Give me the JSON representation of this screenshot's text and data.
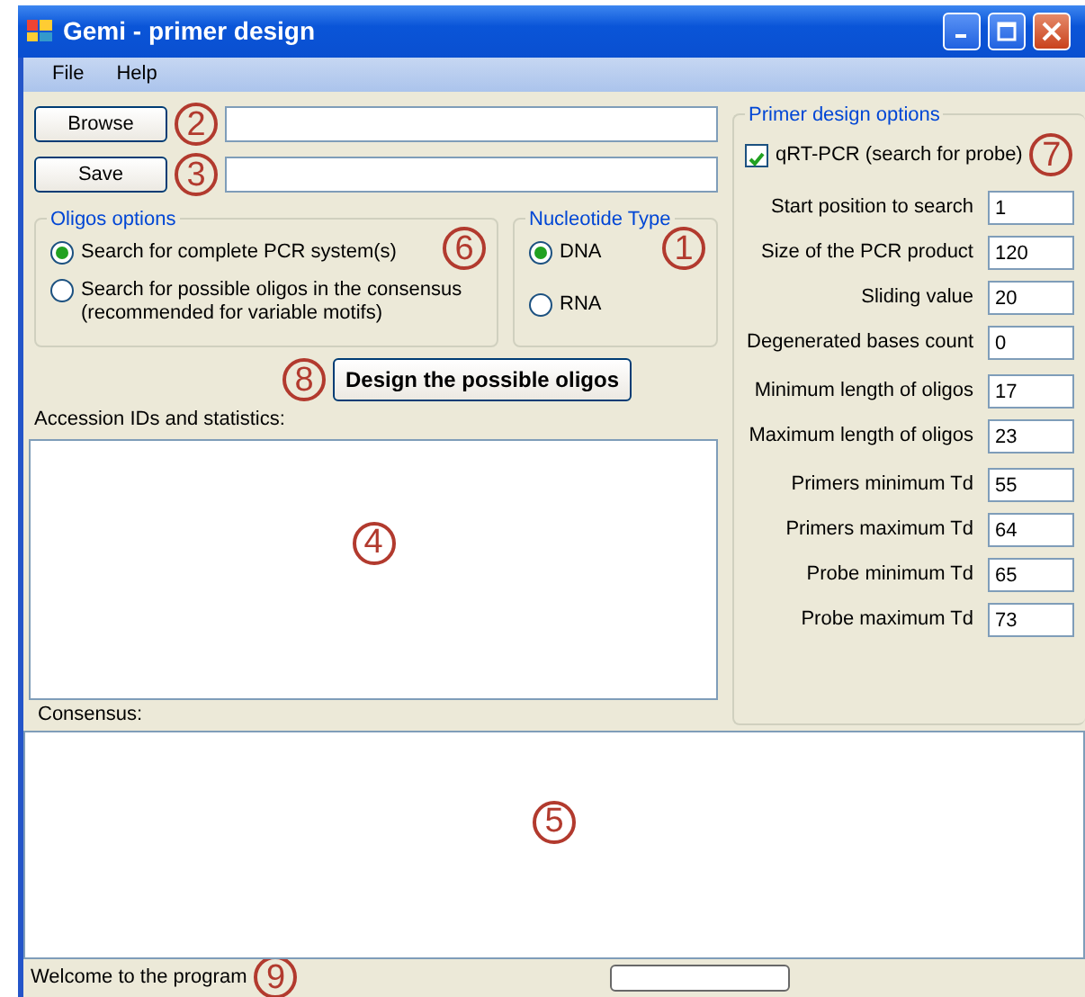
{
  "window": {
    "title": "Gemi - primer design"
  },
  "menu": [
    {
      "label": "File"
    },
    {
      "label": "Help"
    }
  ],
  "file_rows": [
    {
      "button": "Browse",
      "callout": "2"
    },
    {
      "button": "Save",
      "callout": "3"
    }
  ],
  "oligos_options": {
    "title": "Oligos options",
    "callout": "6",
    "options": [
      {
        "label": "Search for complete PCR system(s)",
        "selected": true
      },
      {
        "label": "Search for possible oligos in the consensus\n(recommended for variable motifs)",
        "selected": false
      }
    ]
  },
  "nucleotide_type": {
    "title": "Nucleotide Type",
    "callout": "1",
    "options": [
      {
        "label": "DNA",
        "selected": true
      },
      {
        "label": "RNA",
        "selected": false
      }
    ]
  },
  "design_button": {
    "label": "Design the possible oligos",
    "callout": "8"
  },
  "accession": {
    "label": "Accession IDs and statistics:",
    "callout": "4"
  },
  "primer_options": {
    "title": "Primer design options",
    "callout": "7",
    "checkbox": {
      "label": "qRT-PCR (search for probe)",
      "checked": true
    },
    "groups": [
      {
        "fields": [
          {
            "label": "Start position to search",
            "value": "1"
          },
          {
            "label": "Size of the PCR product",
            "value": "120"
          },
          {
            "label": "Sliding value",
            "value": "20"
          },
          {
            "label": "Degenerated bases count",
            "value": "0"
          }
        ]
      },
      {
        "fields": [
          {
            "label": "Minimum length of oligos",
            "value": "17"
          },
          {
            "label": "Maximum length of oligos",
            "value": "23"
          }
        ]
      },
      {
        "fields": [
          {
            "label": "Primers minimum Td",
            "value": "55"
          },
          {
            "label": "Primers maximum Td",
            "value": "64"
          },
          {
            "label": "Probe minimum Td",
            "value": "65"
          },
          {
            "label": "Probe maximum Td",
            "value": "73"
          }
        ]
      }
    ]
  },
  "consensus": {
    "label": "Consensus:",
    "callout": "5"
  },
  "status_bar": {
    "text": "Welcome to the program",
    "callout": "9"
  }
}
